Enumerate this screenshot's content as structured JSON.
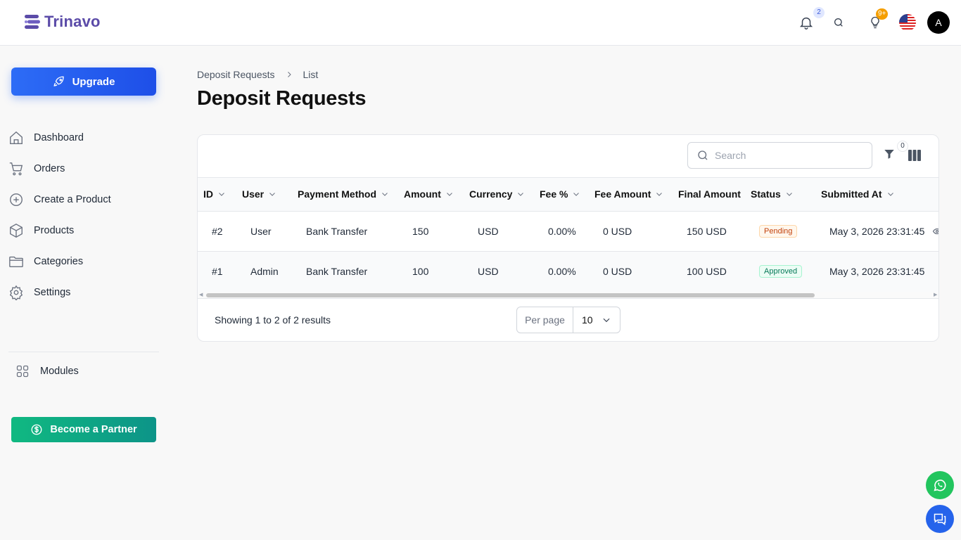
{
  "app": {
    "name": "Trinavo"
  },
  "topbar": {
    "notifications_count": "2",
    "ideas_count": "9+",
    "avatar_initial": "A"
  },
  "sidebar": {
    "upgrade_label": "Upgrade",
    "items": [
      {
        "label": "Dashboard",
        "icon": "home-icon"
      },
      {
        "label": "Orders",
        "icon": "cart-icon"
      },
      {
        "label": "Create a Product",
        "icon": "plus-circle-icon"
      },
      {
        "label": "Products",
        "icon": "box-icon"
      },
      {
        "label": "Categories",
        "icon": "folder-icon"
      },
      {
        "label": "Settings",
        "icon": "gear-icon"
      }
    ],
    "modules_label": "Modules",
    "partner_label": "Become a Partner"
  },
  "breadcrumb": {
    "parent": "Deposit Requests",
    "current": "List"
  },
  "page_title": "Deposit Requests",
  "table": {
    "search_placeholder": "Search",
    "filter_count": "0",
    "columns": [
      "ID",
      "User",
      "Payment Method",
      "Amount",
      "Currency",
      "Fee %",
      "Fee Amount",
      "Final Amount",
      "Status",
      "Submitted At"
    ],
    "rows": [
      {
        "id": "#2",
        "user": "User",
        "method": "Bank Transfer",
        "amount": "150",
        "currency": "USD",
        "fee_pct": "0.00%",
        "fee_amount": "0 USD",
        "final_amount": "150 USD",
        "status": "Pending",
        "submitted": "May 3, 2026 23:31:45"
      },
      {
        "id": "#1",
        "user": "Admin",
        "method": "Bank Transfer",
        "amount": "100",
        "currency": "USD",
        "fee_pct": "0.00%",
        "fee_amount": "0 USD",
        "final_amount": "100 USD",
        "status": "Approved",
        "submitted": "May 3, 2026 23:31:45"
      }
    ],
    "showing_text": "Showing 1 to 2 of 2 results",
    "per_page_label": "Per page",
    "per_page_value": "10"
  },
  "colors": {
    "primary": "#2d6cf6",
    "brand": "#5b4ba8",
    "partner": "#10b981",
    "pending": "#c2410c",
    "approved": "#047857"
  }
}
